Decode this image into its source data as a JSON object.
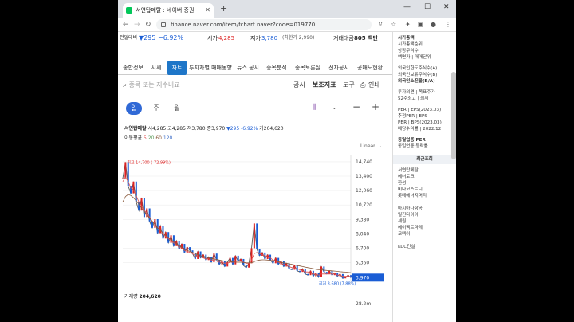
{
  "browser": {
    "tab_title": "서연탑메탈 : 네이버 증권",
    "new_tab": "+",
    "url": "finance.naver.com/item/fchart.naver?code=019770",
    "win_min": "—",
    "win_max": "☐",
    "win_close": "✕"
  },
  "strip": {
    "prev_label": "전일대비",
    "change": "▼295",
    "change_pct": "−6.92%",
    "high_label": "시가",
    "high_value": "4,285",
    "low_label": "저가",
    "low_value": "3,780",
    "low_note": "(하한가 2,990)",
    "amount_label": "거래대금",
    "amount_value": "805 백만"
  },
  "page_tabs": [
    "종합정보",
    "시세",
    "차트",
    "투자자별 매매동향",
    "뉴스 공시",
    "종목분석",
    "종목토론실",
    "전자공시",
    "공매도현황"
  ],
  "search": {
    "placeholder": "종목 또는 지수비교"
  },
  "tools": [
    "공시",
    "보조지표",
    "도구",
    "인쇄"
  ],
  "periods": [
    "일",
    "주",
    "월"
  ],
  "ohlc": {
    "name": "서연탑메탈",
    "open_label": "시",
    "open": "4,285",
    "high_label": "고",
    "high": "4,285",
    "low_label": "저",
    "low": "3,780",
    "close_label": "종",
    "close": "3,970",
    "change": "▼295 -6.92%",
    "volume_label": "거",
    "volume": "204,620"
  },
  "ma": {
    "label": "이동평균",
    "v1": "5",
    "v2": "20",
    "v3": "60",
    "v4": "120"
  },
  "scale_label": "Linear",
  "chart_data": {
    "type": "line",
    "y_ticks": [
      "14,740",
      "13,400",
      "12,060",
      "10,720",
      "9,380",
      "8,040",
      "6,700",
      "5,360",
      "4,020"
    ],
    "ylim": [
      3400,
      15400
    ],
    "max_label": "최고 14,700 (-72.99%)",
    "min_label": "최저 3,680 (7.88%)",
    "current_label": "3,970",
    "series": [
      {
        "values": [
          13200,
          14700,
          12500,
          11800,
          12900,
          11000,
          10200,
          11400,
          9600,
          10400,
          9200,
          8600,
          9400,
          8100,
          8800,
          7600,
          8200,
          7200,
          7900,
          6900,
          7400,
          6600,
          7100,
          6300,
          6800,
          6500,
          6200,
          5700,
          6400,
          5800,
          6100,
          5600,
          5900,
          5400,
          6200,
          5600,
          5200,
          5500,
          5000,
          5400,
          5800,
          5200,
          6000,
          5500,
          5700,
          5100,
          4900,
          5300,
          6700,
          9000,
          6600,
          6000,
          6300,
          5700,
          6100,
          5600,
          5300,
          5800,
          5200,
          5500,
          5000,
          5300,
          4800,
          4700,
          5100,
          4600,
          4500,
          4800,
          4300,
          4200,
          4600,
          4100,
          4400,
          4000,
          5000,
          4500,
          4300,
          4600,
          4200,
          4400,
          4100,
          4300,
          3900,
          4000,
          4200,
          3970
        ]
      },
      {
        "values": [
          12900,
          13300,
          12900,
          12300,
          12100,
          11600,
          11000,
          10600,
          10200,
          10000,
          9600,
          9200,
          9000,
          8600,
          8400,
          8000,
          7800,
          7600,
          7400,
          7200,
          7000,
          6800,
          6700,
          6500,
          6400,
          6300,
          6200,
          6000,
          5900,
          5900,
          5800,
          5700,
          5700,
          5600,
          5600,
          5500,
          5400,
          5400,
          5300,
          5300,
          5400,
          5400,
          5500,
          5500,
          5500,
          5400,
          5300,
          5300,
          5600,
          6200,
          6300,
          6200,
          6100,
          6000,
          5900,
          5800,
          5600,
          5500,
          5400,
          5300,
          5200,
          5100,
          5000,
          4900,
          4900,
          4800,
          4700,
          4600,
          4500,
          4500,
          4400,
          4300,
          4300,
          4200,
          4300,
          4300,
          4300,
          4300,
          4300,
          4300,
          4200,
          4200,
          4100,
          4100,
          4100,
          4050
        ]
      },
      {
        "values": [
          11000,
          11500,
          11700,
          11600,
          11400,
          11100,
          10800,
          10400,
          10100,
          9800,
          9500,
          9200,
          8900,
          8600,
          8400,
          8100,
          7900,
          7700,
          7500,
          7300,
          7100,
          6950,
          6800,
          6650,
          6500,
          6400,
          6300,
          6200,
          6100,
          6000,
          5950,
          5900,
          5800,
          5750,
          5700,
          5650,
          5600,
          5550,
          5500,
          5480,
          5450,
          5420,
          5400,
          5400,
          5400,
          5380,
          5350,
          5330,
          5350,
          5450,
          5550,
          5600,
          5620,
          5620,
          5600,
          5580,
          5550,
          5500,
          5450,
          5400,
          5350,
          5300,
          5250,
          5200,
          5150,
          5100,
          5050,
          5000,
          4950,
          4900,
          4850,
          4800,
          4750,
          4700,
          4680,
          4660,
          4640,
          4620,
          4600,
          4580,
          4550,
          4520,
          4500,
          4480,
          4450,
          4420
        ]
      }
    ],
    "volume_label": "거래량",
    "volume_value": "204,620",
    "volume_axis": "28.2m"
  },
  "right_panel": {
    "top": [
      "시가총액",
      "시가총액순위",
      "상장주식수",
      "액면가 | 매매단위"
    ],
    "foreign": [
      "외국인한도주식수(A)",
      "외국인보유주식수(B)",
      "외국인소진율(B/A)"
    ],
    "opinion": [
      "투자의견 | 목표주가",
      "52주최고 | 최저"
    ],
    "per": [
      "PER | EPS(2023.03)",
      "추정PER | EPS",
      "PBR | BPS(2023.03)",
      "배당수익률 | 2022.12"
    ],
    "same": [
      "동일업종 PER",
      "동일업종 등락률"
    ],
    "recent_header": "최근조회",
    "recent": [
      "서연탑메탈",
      "에너토크",
      "한섬",
      "비다코스트디",
      "롯데에너지머티",
      "",
      "아시아나항공",
      "일진다이아",
      "셰원",
      "에이팩트마테",
      "코텍이",
      "",
      "KCC건설"
    ]
  },
  "colors": {
    "accent": "#1e76c8",
    "down": "#1a5dd5",
    "up": "#dd2222",
    "ma5": "#e05252",
    "ma20": "#5a9a5a",
    "ma60": "#8a5a3c"
  }
}
